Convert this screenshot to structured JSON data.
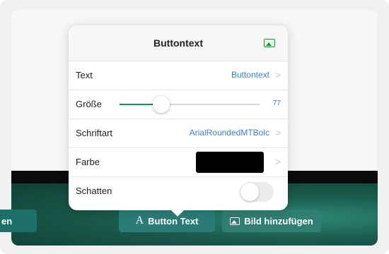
{
  "popover": {
    "title": "Buttontext",
    "rows": {
      "text": {
        "label": "Text",
        "value": "Buttontext",
        "chevron": ">"
      },
      "size": {
        "label": "Größe",
        "value": "77",
        "slider_fraction": 0.3
      },
      "font": {
        "label": "Schriftart",
        "value": "ArialRoundedMTBolc",
        "chevron": ">"
      },
      "color": {
        "label": "Farbe",
        "value_color": "#000000",
        "chevron": ">"
      },
      "shadow": {
        "label": "Schatten",
        "toggle_on": false
      }
    }
  },
  "toolbar": {
    "left_partial_label": "en",
    "button_text": {
      "glyph": "A",
      "label": "Button Text"
    },
    "add_image": {
      "label": "Bild hinzufügen"
    }
  },
  "colors": {
    "accent_blue": "#3b7fd9",
    "slider_green": "#19905b",
    "toolbar_teal": "#2a7d76"
  }
}
